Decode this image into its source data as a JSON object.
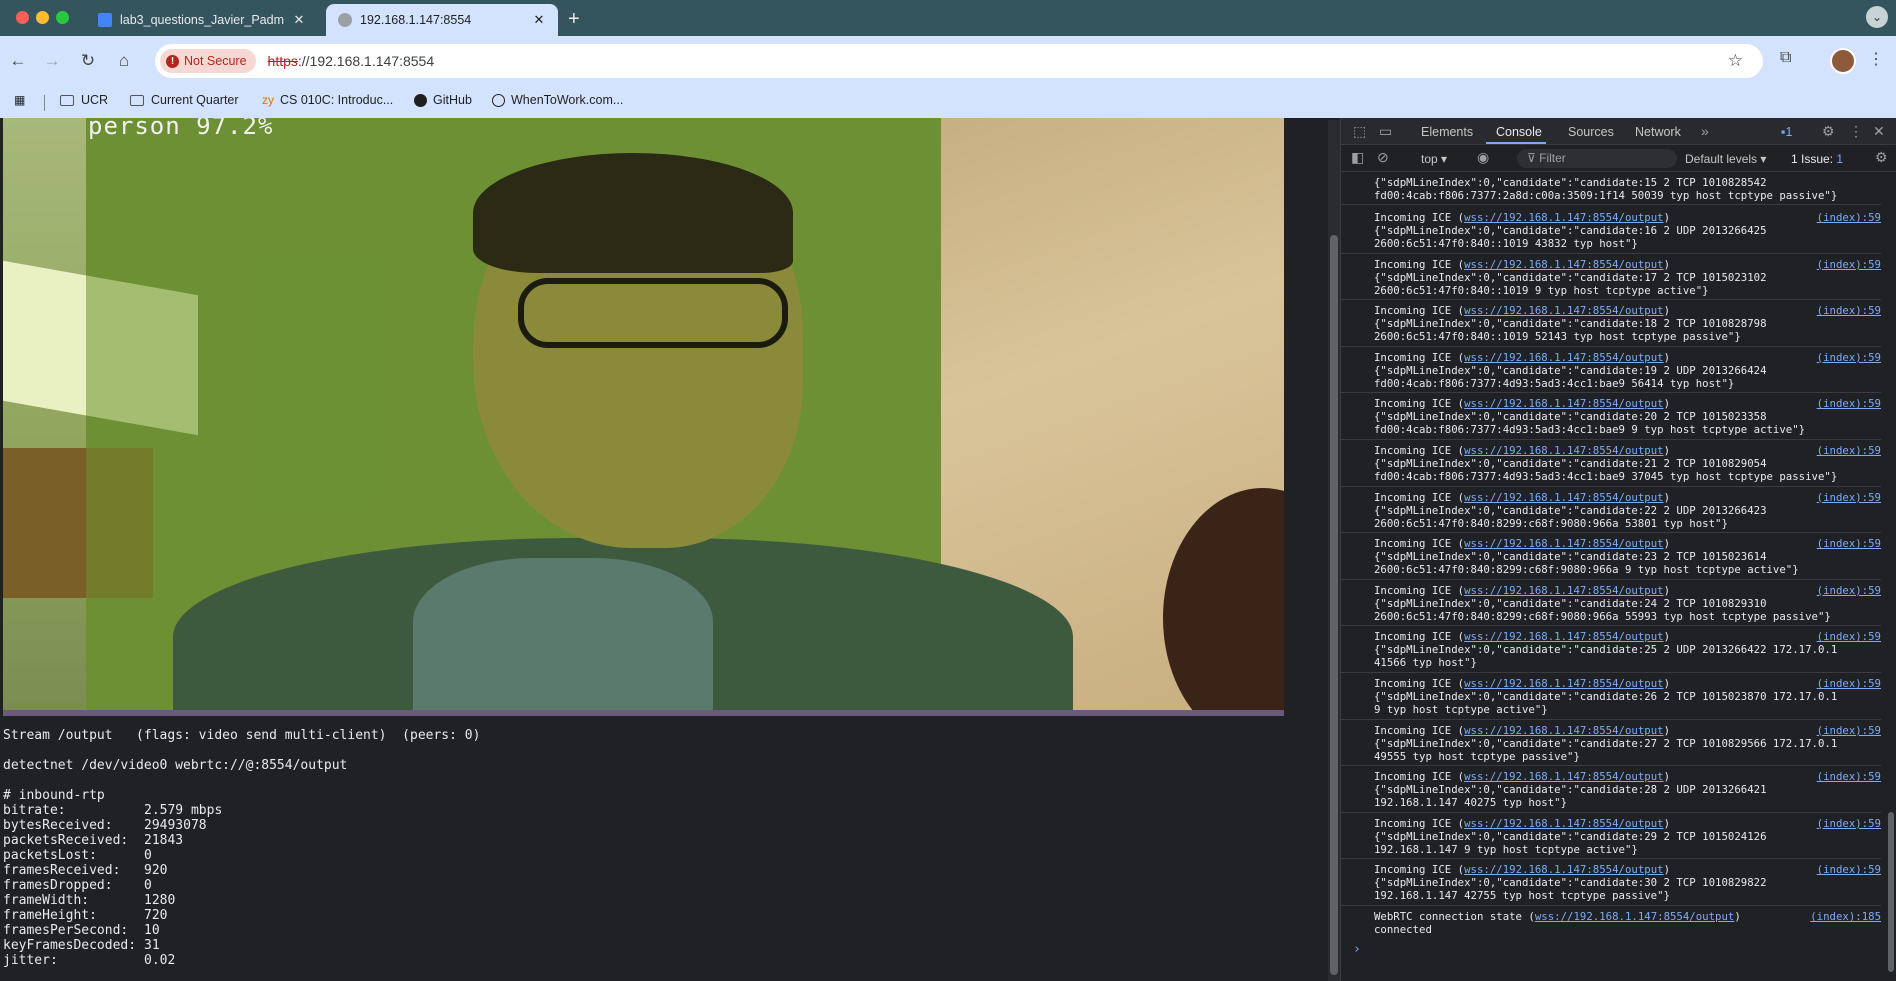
{
  "tabs": [
    {
      "title": "lab3_questions_Javier_Padm",
      "active": false
    },
    {
      "title": "192.168.1.147:8554",
      "active": true
    }
  ],
  "address_bar": {
    "security_label": "Not Secure",
    "url_scheme": "https",
    "url_rest": "://192.168.1.147:8554"
  },
  "bookmarks": [
    {
      "label": "UCR",
      "icon": "folder-icon"
    },
    {
      "label": "Current Quarter",
      "icon": "folder-icon"
    },
    {
      "label": "CS 010C: Introduc...",
      "icon": "bookmark-icon"
    },
    {
      "label": "GitHub",
      "icon": "github-icon"
    },
    {
      "label": "WhenToWork.com...",
      "icon": "bookmark-icon"
    }
  ],
  "video": {
    "detection_label": "person 97.2%"
  },
  "stream": {
    "info": "Stream /output   (flags: video send multi-client)  (peers: 0)",
    "command": "detectnet /dev/video0 webrtc://@:8554/output",
    "section": "# inbound-rtp",
    "stats": [
      {
        "key": "bitrate:",
        "value": "2.579 mbps"
      },
      {
        "key": "bytesReceived:",
        "value": "29493078"
      },
      {
        "key": "packetsReceived:",
        "value": "21843"
      },
      {
        "key": "packetsLost:",
        "value": "0"
      },
      {
        "key": "framesReceived:",
        "value": "920"
      },
      {
        "key": "framesDropped:",
        "value": "0"
      },
      {
        "key": "frameWidth:",
        "value": "1280"
      },
      {
        "key": "frameHeight:",
        "value": "720"
      },
      {
        "key": "framesPerSecond:",
        "value": "10"
      },
      {
        "key": "keyFramesDecoded:",
        "value": "31"
      },
      {
        "key": "jitter:",
        "value": "0.02"
      }
    ]
  },
  "devtools": {
    "tabs": [
      "Elements",
      "Console",
      "Sources",
      "Network"
    ],
    "active_tab": "Console",
    "issues_badge": "1",
    "context": "top",
    "filter_placeholder": "Filter",
    "levels": "Default levels",
    "issues_label": "1 Issue:",
    "issues_count": "1",
    "top_partial": "{\"sdpMLineIndex\":0,\"candidate\":\"candidate:15 2 TCP 1010828542",
    "top_partial2": "fd00:4cab:f806:7377:2a8d:c00a:3509:1f14 50039 typ host tcptype passive\"}",
    "ice_prefix": "Incoming ICE (",
    "ice_link": "wss://192.168.1.147:8554/output",
    "source": "(index):59",
    "messages": [
      {
        "l2": "{\"sdpMLineIndex\":0,\"candidate\":\"candidate:16 2 UDP 2013266425",
        "l3": "2600:6c51:47f0:840::1019 43832 typ host\"}"
      },
      {
        "l2": "{\"sdpMLineIndex\":0,\"candidate\":\"candidate:17 2 TCP 1015023102",
        "l3": "2600:6c51:47f0:840::1019 9 typ host tcptype active\"}"
      },
      {
        "l2": "{\"sdpMLineIndex\":0,\"candidate\":\"candidate:18 2 TCP 1010828798",
        "l3": "2600:6c51:47f0:840::1019 52143 typ host tcptype passive\"}"
      },
      {
        "l2": "{\"sdpMLineIndex\":0,\"candidate\":\"candidate:19 2 UDP 2013266424",
        "l3": "fd00:4cab:f806:7377:4d93:5ad3:4cc1:bae9 56414 typ host\"}"
      },
      {
        "l2": "{\"sdpMLineIndex\":0,\"candidate\":\"candidate:20 2 TCP 1015023358",
        "l3": "fd00:4cab:f806:7377:4d93:5ad3:4cc1:bae9 9 typ host tcptype active\"}"
      },
      {
        "l2": "{\"sdpMLineIndex\":0,\"candidate\":\"candidate:21 2 TCP 1010829054",
        "l3": "fd00:4cab:f806:7377:4d93:5ad3:4cc1:bae9 37045 typ host tcptype passive\"}"
      },
      {
        "l2": "{\"sdpMLineIndex\":0,\"candidate\":\"candidate:22 2 UDP 2013266423",
        "l3": "2600:6c51:47f0:840:8299:c68f:9080:966a 53801 typ host\"}"
      },
      {
        "l2": "{\"sdpMLineIndex\":0,\"candidate\":\"candidate:23 2 TCP 1015023614",
        "l3": "2600:6c51:47f0:840:8299:c68f:9080:966a 9 typ host tcptype active\"}"
      },
      {
        "l2": "{\"sdpMLineIndex\":0,\"candidate\":\"candidate:24 2 TCP 1010829310",
        "l3": "2600:6c51:47f0:840:8299:c68f:9080:966a 55993 typ host tcptype passive\"}"
      },
      {
        "l2": "{\"sdpMLineIndex\":0,\"candidate\":\"candidate:25 2 UDP 2013266422 172.17.0.1",
        "l3": "41566 typ host\"}"
      },
      {
        "l2": "{\"sdpMLineIndex\":0,\"candidate\":\"candidate:26 2 TCP 1015023870 172.17.0.1",
        "l3": "9 typ host tcptype active\"}"
      },
      {
        "l2": "{\"sdpMLineIndex\":0,\"candidate\":\"candidate:27 2 TCP 1010829566 172.17.0.1",
        "l3": "49555 typ host tcptype passive\"}"
      },
      {
        "l2": "{\"sdpMLineIndex\":0,\"candidate\":\"candidate:28 2 UDP 2013266421",
        "l3": "192.168.1.147 40275 typ host\"}"
      },
      {
        "l2": "{\"sdpMLineIndex\":0,\"candidate\":\"candidate:29 2 TCP 1015024126",
        "l3": "192.168.1.147 9 typ host tcptype active\"}"
      },
      {
        "l2": "{\"sdpMLineIndex\":0,\"candidate\":\"candidate:30 2 TCP 1010829822",
        "l3": "192.168.1.147 42755 typ host tcptype passive\"}"
      }
    ],
    "webrtc_prefix": "WebRTC connection state (",
    "webrtc_link": "wss://192.168.1.147:8554/output",
    "webrtc_source": "(index):185",
    "webrtc_state": "connected"
  },
  "colors": {
    "tabstrip": "#35555e",
    "toolbar": "#d3e3fd",
    "devtools_bg": "#202124",
    "link": "#7cacf8"
  }
}
